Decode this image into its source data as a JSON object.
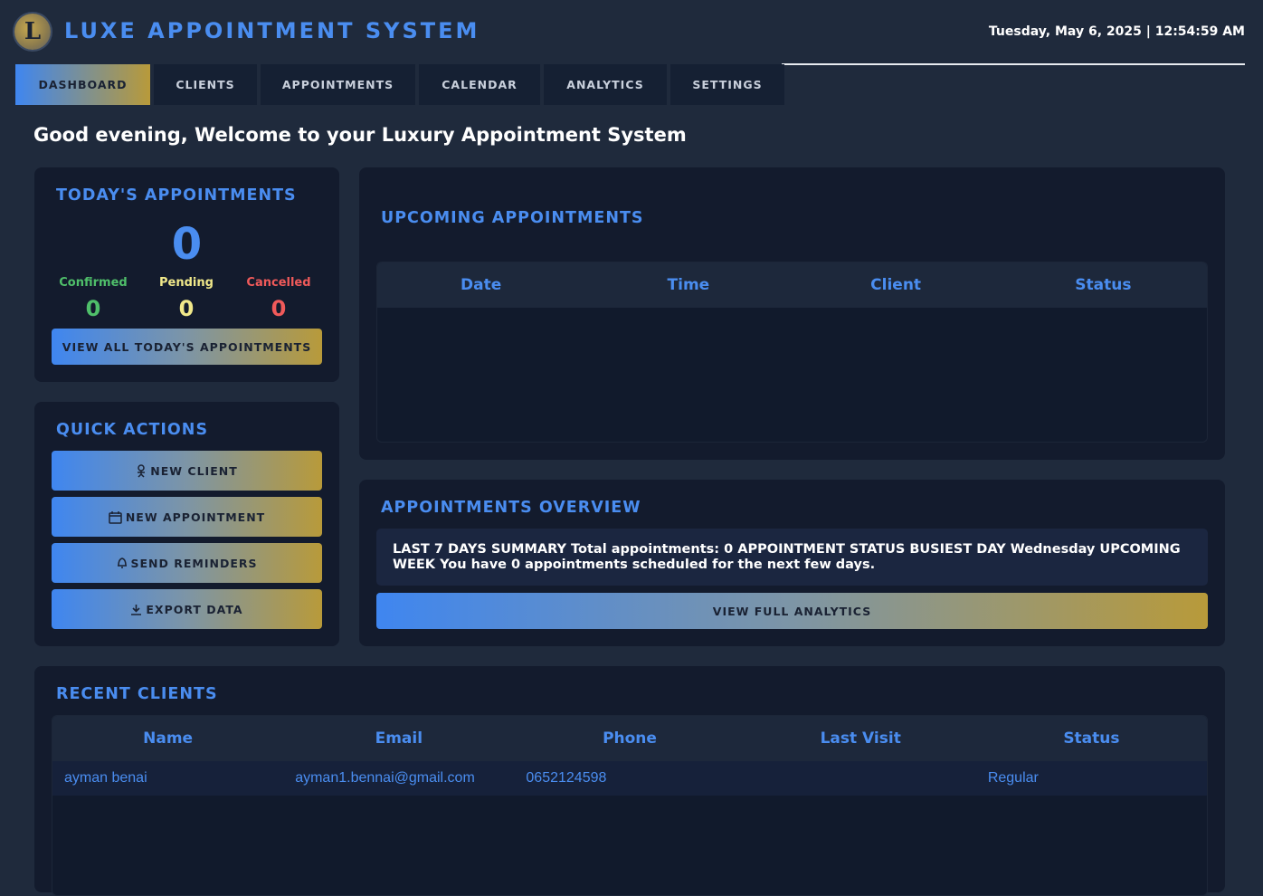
{
  "header": {
    "logo_letter": "L",
    "app_title": "LUXE APPOINTMENT SYSTEM",
    "datetime": "Tuesday, May 6, 2025 | 12:54:59 AM"
  },
  "tabs": [
    {
      "label": "DASHBOARD",
      "active": true
    },
    {
      "label": "CLIENTS",
      "active": false
    },
    {
      "label": "APPOINTMENTS",
      "active": false
    },
    {
      "label": "CALENDAR",
      "active": false
    },
    {
      "label": "ANALYTICS",
      "active": false
    },
    {
      "label": "SETTINGS",
      "active": false
    }
  ],
  "greeting": "Good evening, Welcome to your Luxury Appointment System",
  "today": {
    "title": "TODAY'S APPOINTMENTS",
    "total": "0",
    "confirmed_label": "Confirmed",
    "confirmed_value": "0",
    "pending_label": "Pending",
    "pending_value": "0",
    "cancelled_label": "Cancelled",
    "cancelled_value": "0",
    "view_all_label": "VIEW ALL TODAY'S APPOINTMENTS"
  },
  "quick_actions": {
    "title": "QUICK ACTIONS",
    "new_client": "NEW CLIENT",
    "new_appointment": "NEW APPOINTMENT",
    "send_reminders": "SEND REMINDERS",
    "export_data": "EXPORT DATA"
  },
  "upcoming": {
    "title": "UPCOMING APPOINTMENTS",
    "columns": [
      "Date",
      "Time",
      "Client",
      "Status"
    ]
  },
  "overview": {
    "title": "APPOINTMENTS OVERVIEW",
    "summary": "LAST 7 DAYS SUMMARY Total appointments: 0 APPOINTMENT STATUS BUSIEST DAY Wednesday UPCOMING WEEK You have 0 appointments scheduled for the next few days.",
    "button": "VIEW FULL ANALYTICS"
  },
  "recent_clients": {
    "title": "RECENT CLIENTS",
    "columns": [
      "Name",
      "Email",
      "Phone",
      "Last Visit",
      "Status"
    ],
    "rows": [
      {
        "name": "ayman benai",
        "email": "ayman1.bennai@gmail.com",
        "phone": "0652124598",
        "last_visit": "",
        "status": "Regular"
      }
    ]
  },
  "colors": {
    "accent_blue": "#4a8df0",
    "accent_gold": "#b89a3a",
    "confirmed": "#4fbf6a",
    "pending": "#f0e88a",
    "cancelled": "#f05a5a",
    "background": "#1f2a3c",
    "card": "#131b2d"
  }
}
